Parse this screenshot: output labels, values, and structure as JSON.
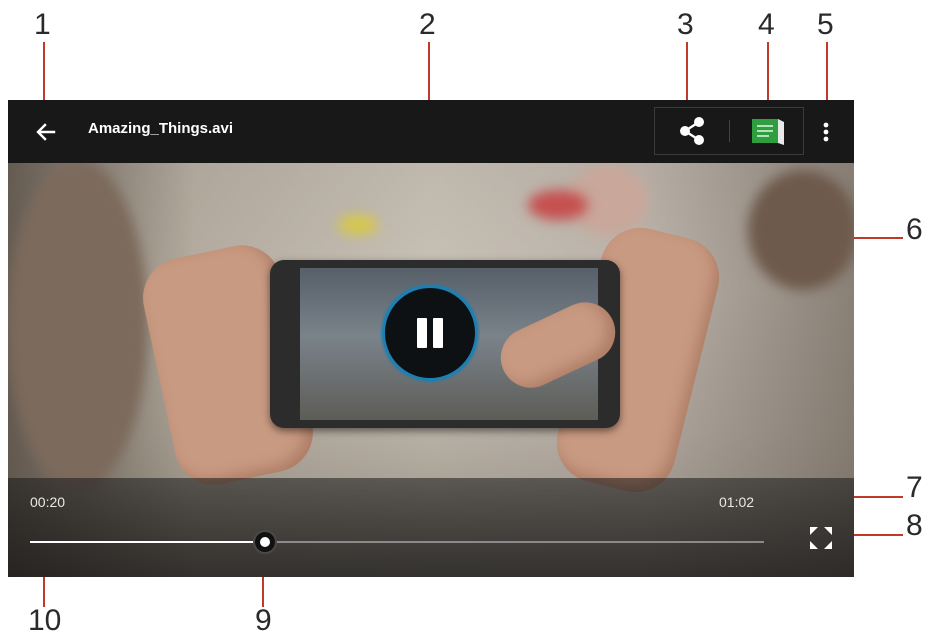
{
  "callouts": [
    "1",
    "2",
    "3",
    "4",
    "5",
    "6",
    "7",
    "8",
    "9",
    "10"
  ],
  "header": {
    "title": "Amazing_Things.avi",
    "back_icon": "arrow-left-icon",
    "share_icon": "share-icon",
    "notes_icon": "notes-icon",
    "menu_icon": "more-vert-icon"
  },
  "player": {
    "state_icon": "pause-icon",
    "elapsed": "00:20",
    "duration": "01:02",
    "progress": 0.32,
    "fullscreen_icon": "fullscreen-icon"
  },
  "colors": {
    "accent": "#1e7fb2",
    "leader": "#c0392b",
    "bar": "#181818",
    "notes_green": "#2e9e3e"
  }
}
